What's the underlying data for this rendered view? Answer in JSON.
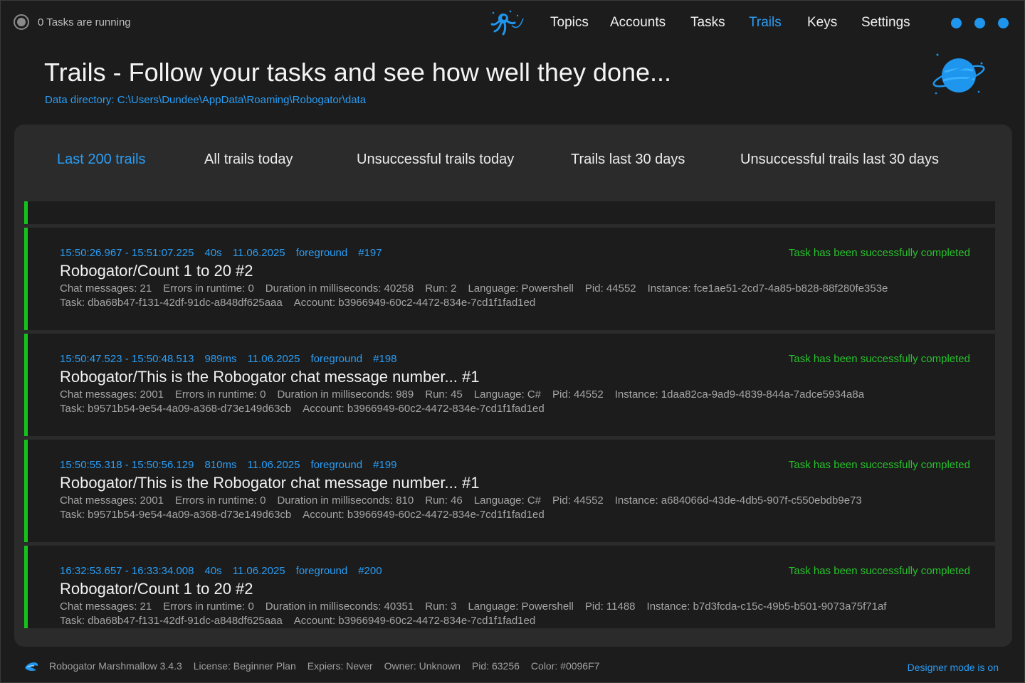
{
  "status": {
    "text": "0 Tasks are running"
  },
  "nav": {
    "items": [
      {
        "label": "Topics",
        "active": false
      },
      {
        "label": "Accounts",
        "active": false
      },
      {
        "label": "Tasks",
        "active": false
      },
      {
        "label": "Trails",
        "active": true
      },
      {
        "label": "Keys",
        "active": false
      },
      {
        "label": "Settings",
        "active": false
      }
    ]
  },
  "header": {
    "title": "Trails - Follow your tasks and see how well they done...",
    "data_directory": "Data directory: C:\\Users\\Dundee\\AppData\\Roaming\\Robogator\\data"
  },
  "tabs": [
    {
      "label": "Last 200 trails",
      "active": true
    },
    {
      "label": "All trails today",
      "active": false
    },
    {
      "label": "Unsuccessful trails today",
      "active": false
    },
    {
      "label": "Trails last 30 days",
      "active": false
    },
    {
      "label": "Unsuccessful trails last 30 days",
      "active": false
    }
  ],
  "trails": [
    {
      "time_range": "15:50:26.967 - 15:51:07.225",
      "duration": "40s",
      "date": "11.06.2025",
      "mode": "foreground",
      "number": "#197",
      "result": "Task has been successfully completed",
      "title": "Robogator/Count 1 to 20 #2",
      "chat_messages": "Chat messages: 21",
      "errors": "Errors in runtime: 0",
      "duration_ms": "Duration in milliseconds: 40258",
      "run": "Run: 2",
      "language": "Language: Powershell",
      "pid": "Pid: 44552",
      "instance": "Instance: fce1ae51-2cd7-4a85-b828-88f280fe353e",
      "task": "Task: dba68b47-f131-42df-91dc-a848df625aaa",
      "account": "Account: b3966949-60c2-4472-834e-7cd1f1fad1ed"
    },
    {
      "time_range": "15:50:47.523 - 15:50:48.513",
      "duration": "989ms",
      "date": "11.06.2025",
      "mode": "foreground",
      "number": "#198",
      "result": "Task has been successfully completed",
      "title": "Robogator/This is the Robogator chat message number... #1",
      "chat_messages": "Chat messages: 2001",
      "errors": "Errors in runtime: 0",
      "duration_ms": "Duration in milliseconds: 989",
      "run": "Run: 45",
      "language": "Language: C#",
      "pid": "Pid: 44552",
      "instance": "Instance: 1daa82ca-9ad9-4839-844a-7adce5934a8a",
      "task": "Task: b9571b54-9e54-4a09-a368-d73e149d63cb",
      "account": "Account: b3966949-60c2-4472-834e-7cd1f1fad1ed"
    },
    {
      "time_range": "15:50:55.318 - 15:50:56.129",
      "duration": "810ms",
      "date": "11.06.2025",
      "mode": "foreground",
      "number": "#199",
      "result": "Task has been successfully completed",
      "title": "Robogator/This is the Robogator chat message number... #1",
      "chat_messages": "Chat messages: 2001",
      "errors": "Errors in runtime: 0",
      "duration_ms": "Duration in milliseconds: 810",
      "run": "Run: 46",
      "language": "Language: C#",
      "pid": "Pid: 44552",
      "instance": "Instance: a684066d-43de-4db5-907f-c550ebdb9e73",
      "task": "Task: b9571b54-9e54-4a09-a368-d73e149d63cb",
      "account": "Account: b3966949-60c2-4472-834e-7cd1f1fad1ed"
    },
    {
      "time_range": "16:32:53.657 - 16:33:34.008",
      "duration": "40s",
      "date": "11.06.2025",
      "mode": "foreground",
      "number": "#200",
      "result": "Task has been successfully completed",
      "title": "Robogator/Count 1 to 20 #2",
      "chat_messages": "Chat messages: 21",
      "errors": "Errors in runtime: 0",
      "duration_ms": "Duration in milliseconds: 40351",
      "run": "Run: 3",
      "language": "Language: Powershell",
      "pid": "Pid: 11488",
      "instance": "Instance: b7d3fcda-c15c-49b5-b501-9073a75f71af",
      "task": "Task: dba68b47-f131-42df-91dc-a848df625aaa",
      "account": "Account: b3966949-60c2-4472-834e-7cd1f1fad1ed"
    }
  ],
  "footer": {
    "product": "Robogator Marshmallow 3.4.3",
    "license": "License: Beginner Plan",
    "expires": "Expiers: Never",
    "owner": "Owner: Unknown",
    "pid": "Pid: 63256",
    "color": "Color: #0096F7",
    "designer_mode": "Designer mode is on"
  },
  "colors": {
    "accent": "#2A9DF4",
    "success": "#15C21B",
    "background": "#1C1C1C",
    "panel": "#2B2B2B"
  },
  "icons": {
    "status": "status-indicator-icon",
    "nav_logo": "astronaut-octopus-logo-icon",
    "header": "planet-icon",
    "footer": "robogator-logo-icon"
  }
}
